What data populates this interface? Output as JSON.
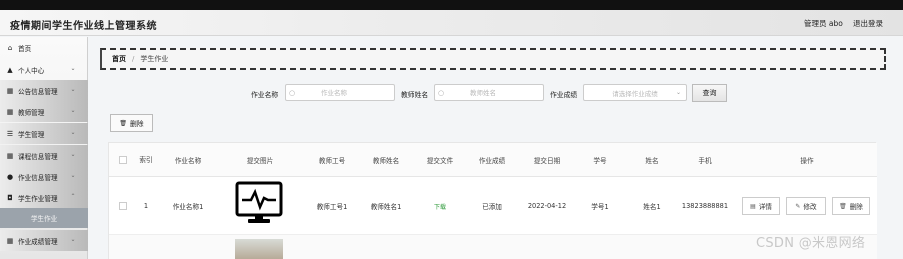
{
  "header": {
    "title": "疫情期间学生作业线上管理系统",
    "admin": "管理员 abo",
    "logout": "退出登录"
  },
  "sidebar": {
    "items": [
      {
        "label": "首页",
        "icon": "home-icon"
      },
      {
        "label": "个人中心",
        "icon": "user-icon"
      },
      {
        "label": "公告信息管理",
        "icon": "grid-icon"
      },
      {
        "label": "教师管理",
        "icon": "grid-icon"
      },
      {
        "label": "学生管理",
        "icon": "sliders-icon"
      },
      {
        "label": "课程信息管理",
        "icon": "grid-icon"
      },
      {
        "label": "作业信息管理",
        "icon": "pin-icon"
      },
      {
        "label": "学生作业管理",
        "icon": "book-icon"
      },
      {
        "label": "学生作业",
        "icon": ""
      },
      {
        "label": "作业成绩管理",
        "icon": "grid-icon"
      }
    ]
  },
  "breadcrumb": {
    "home": "首页",
    "sep": "/",
    "current": "学生作业"
  },
  "search": {
    "name_label": "作业名称",
    "name_placeholder": "作业名称",
    "teacher_label": "教师姓名",
    "teacher_placeholder": "教师姓名",
    "score_label": "作业成绩",
    "score_placeholder": "请选择作业成绩",
    "query_button": "查询"
  },
  "toolbar": {
    "delete": "删除"
  },
  "table": {
    "headers": [
      "索引",
      "作业名称",
      "提交图片",
      "教师工号",
      "教师姓名",
      "提交文件",
      "作业成绩",
      "提交日期",
      "学号",
      "姓名",
      "手机",
      "操作"
    ],
    "rows": [
      {
        "index": "1",
        "name": "作业名称1",
        "teacher_id": "教师工号1",
        "teacher_name": "教师姓名1",
        "file": "下载",
        "score": "已添加",
        "date": "2022-04-12",
        "student_id": "学号1",
        "student_name": "姓名1",
        "phone": "13823888881"
      }
    ],
    "actions": {
      "detail": "详情",
      "edit": "修改",
      "delete": "删除"
    }
  },
  "watermark": "CSDN @米恩网络"
}
